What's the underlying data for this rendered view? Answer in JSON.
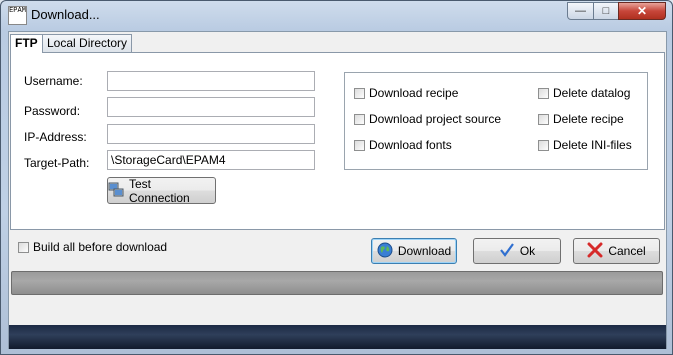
{
  "window": {
    "title": "Download...",
    "icon_text": "EPAM"
  },
  "tabs": [
    {
      "label": "FTP"
    },
    {
      "label": "Local Directory"
    }
  ],
  "ftp": {
    "username_label": "Username:",
    "password_label": "Password:",
    "ip_label": "IP-Address:",
    "target_label": "Target-Path:",
    "username_value": "",
    "password_value": "",
    "ip_value": "",
    "target_value": "\\StorageCard\\EPAM4",
    "test_button": "Test Connection"
  },
  "options": {
    "download_recipe": "Download recipe",
    "download_project_source": "Download project source",
    "download_fonts": "Download fonts",
    "delete_datalog": "Delete datalog",
    "delete_recipe": "Delete recipe",
    "delete_ini": "Delete INI-files"
  },
  "bottom": {
    "build_all": "Build all before download",
    "download_button": "Download",
    "ok_button": "Ok",
    "cancel_button": "Cancel"
  },
  "colors": {
    "ok_check": "#2f6fd0",
    "cancel_x": "#d62a2a",
    "progress_fill": "#9b9b9b"
  },
  "icons": [
    "app-icon",
    "minimize-icon",
    "maximize-icon",
    "close-icon",
    "network-icon",
    "globe-icon",
    "checkmark-icon",
    "red-x-icon"
  ]
}
